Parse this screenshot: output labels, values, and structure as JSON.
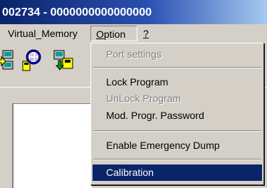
{
  "window": {
    "title": "002734 - 0000000000000000"
  },
  "menubar": {
    "items": [
      {
        "label": "Virtual_Memory"
      },
      {
        "label": "Option",
        "accel": "O",
        "rest": "ption"
      },
      {
        "label": "?"
      }
    ]
  },
  "toolbar": {
    "icons": [
      "transfer-icon",
      "sensor-module-icon",
      "download-icon"
    ],
    "sensor_badge_text": "12 3\n51.3"
  },
  "option_menu": {
    "items": [
      {
        "label": "Port settings",
        "enabled": false
      },
      {
        "label": "Lock Program",
        "enabled": true
      },
      {
        "label": "UnLock Program",
        "enabled": false
      },
      {
        "label": "Mod. Progr. Password",
        "enabled": true
      },
      {
        "label": "Enable Emergency Dump",
        "enabled": true
      },
      {
        "label": "Calibration",
        "enabled": true,
        "selected": true
      }
    ]
  },
  "colors": {
    "titlebar_start": "#0a246a",
    "titlebar_end": "#a6caf0",
    "selection": "#0a246a",
    "face": "#d4d0c8",
    "disabled_text": "#808080"
  }
}
